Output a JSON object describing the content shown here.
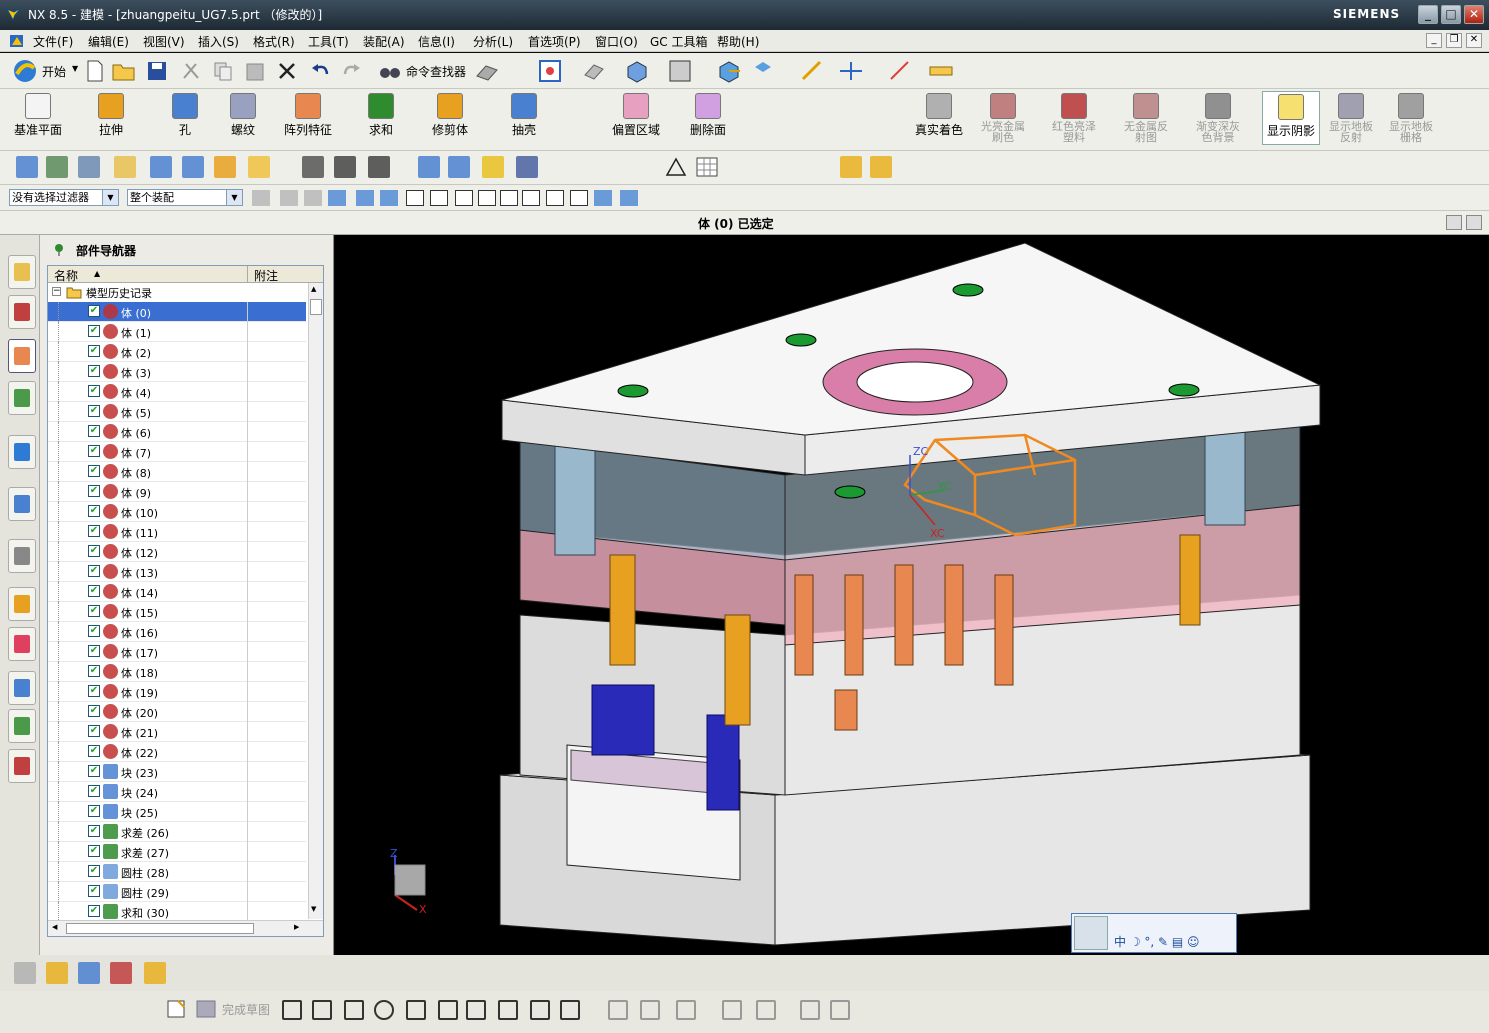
{
  "window": {
    "title": "NX 8.5 - 建模 - [zhuangpeitu_UG7.5.prt （修改的）]",
    "brand": "SIEMENS",
    "min": "_",
    "max": "□",
    "close": "✕"
  },
  "menu": [
    "文件(F)",
    "编辑(E)",
    "视图(V)",
    "插入(S)",
    "格式(R)",
    "工具(T)",
    "装配(A)",
    "信息(I)",
    "分析(L)",
    "首选项(P)",
    "窗口(O)",
    "GC 工具箱",
    "帮助(H)"
  ],
  "toolbar1": {
    "start_label": "开始",
    "cmd_finder_label": "命令查找器"
  },
  "toolbar2": {
    "buttons": [
      "基准平面",
      "拉伸",
      "孔",
      "螺纹",
      "阵列特征",
      "求和",
      "修剪体",
      "抽壳",
      "偏置区域",
      "删除面",
      "真实着色",
      "光亮金属刷色",
      "红色亮泽塑料",
      "无金属反射图",
      "渐变深灰色背景",
      "显示阴影",
      "显示地板反射",
      "显示地板栅格"
    ]
  },
  "filterbar": {
    "filter_value": "没有选择过滤器",
    "scope_value": "整个装配"
  },
  "status": {
    "message": "体 (0)  已选定"
  },
  "navigator": {
    "title": "部件导航器",
    "col_name": "名称",
    "col_note": "附注",
    "root": "模型历史记录",
    "items": [
      {
        "label": "体 (0)",
        "kind": "body"
      },
      {
        "label": "体 (1)",
        "kind": "body"
      },
      {
        "label": "体 (2)",
        "kind": "body"
      },
      {
        "label": "体 (3)",
        "kind": "body"
      },
      {
        "label": "体 (4)",
        "kind": "body"
      },
      {
        "label": "体 (5)",
        "kind": "body"
      },
      {
        "label": "体 (6)",
        "kind": "body"
      },
      {
        "label": "体 (7)",
        "kind": "body"
      },
      {
        "label": "体 (8)",
        "kind": "body"
      },
      {
        "label": "体 (9)",
        "kind": "body"
      },
      {
        "label": "体 (10)",
        "kind": "body"
      },
      {
        "label": "体 (11)",
        "kind": "body"
      },
      {
        "label": "体 (12)",
        "kind": "body"
      },
      {
        "label": "体 (13)",
        "kind": "body"
      },
      {
        "label": "体 (14)",
        "kind": "body"
      },
      {
        "label": "体 (15)",
        "kind": "body"
      },
      {
        "label": "体 (16)",
        "kind": "body"
      },
      {
        "label": "体 (17)",
        "kind": "body"
      },
      {
        "label": "体 (18)",
        "kind": "body"
      },
      {
        "label": "体 (19)",
        "kind": "body"
      },
      {
        "label": "体 (20)",
        "kind": "body"
      },
      {
        "label": "体 (21)",
        "kind": "body"
      },
      {
        "label": "体 (22)",
        "kind": "body"
      },
      {
        "label": "块 (23)",
        "kind": "block"
      },
      {
        "label": "块 (24)",
        "kind": "block"
      },
      {
        "label": "块 (25)",
        "kind": "block"
      },
      {
        "label": "求差 (26)",
        "kind": "subtract"
      },
      {
        "label": "求差 (27)",
        "kind": "subtract"
      },
      {
        "label": "圆柱 (28)",
        "kind": "cylinder"
      },
      {
        "label": "圆柱 (29)",
        "kind": "cylinder"
      },
      {
        "label": "求和 (30)",
        "kind": "unite"
      }
    ]
  },
  "viewport": {
    "axis_zc": "ZC",
    "axis_yc": "YC",
    "axis_xc": "XC",
    "triad_z": "Z",
    "triad_x": "X"
  },
  "ime": {
    "text": "中 ☽ °, ✎ ▤ ☺"
  },
  "bottombar": {
    "finish_sketch": "完成草图"
  }
}
